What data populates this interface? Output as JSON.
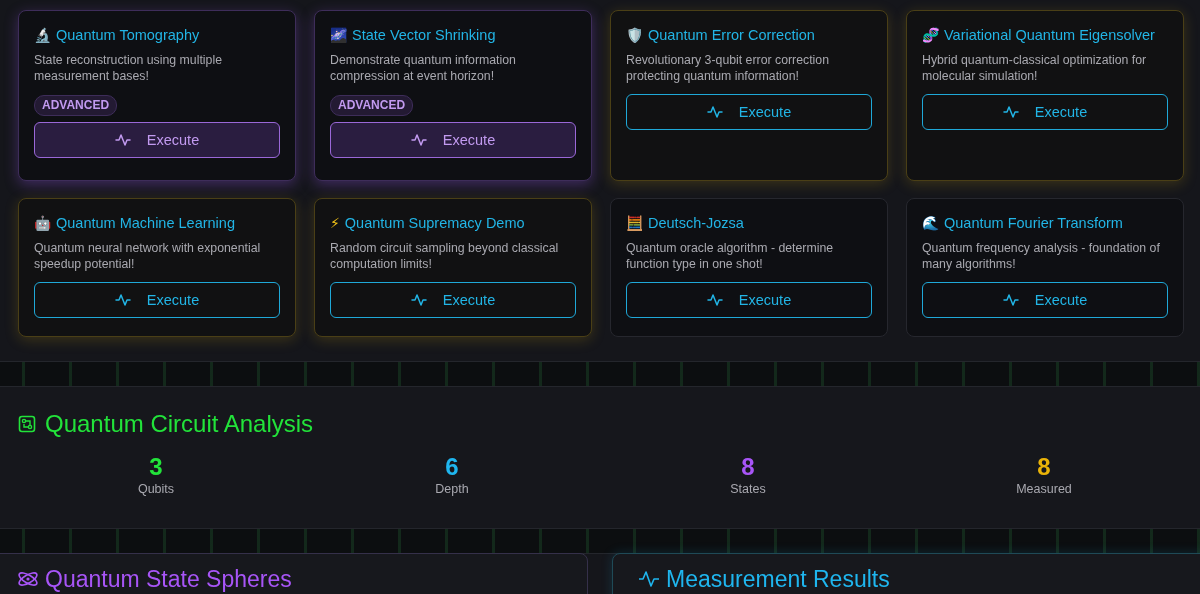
{
  "algorithms": [
    {
      "icon": "🔬",
      "title": "Quantum Tomography",
      "description": "State reconstruction using multiple measurement bases!",
      "badge": "ADVANCED",
      "kind": "advanced",
      "button": "Execute"
    },
    {
      "icon": "🌌",
      "title": "State Vector Shrinking",
      "description": "Demonstrate quantum information compression at event horizon!",
      "badge": "ADVANCED",
      "kind": "advanced",
      "button": "Execute"
    },
    {
      "icon": "🛡️",
      "title": "Quantum Error Correction",
      "description": "Revolutionary 3-qubit error correction protecting quantum information!",
      "kind": "featured",
      "button": "Execute"
    },
    {
      "icon": "🧬",
      "title": "Variational Quantum Eigensolver",
      "description": "Hybrid quantum-classical optimization for molecular simulation!",
      "kind": "featured",
      "button": "Execute"
    },
    {
      "icon": "🤖",
      "title": "Quantum Machine Learning",
      "description": "Quantum neural network with exponential speedup potential!",
      "kind": "featured",
      "button": "Execute"
    },
    {
      "icon": "⚡",
      "title": "Quantum Supremacy Demo",
      "description": "Random circuit sampling beyond classical computation limits!",
      "kind": "featured",
      "button": "Execute"
    },
    {
      "icon": "🧮",
      "title": "Deutsch-Jozsa",
      "description": "Quantum oracle algorithm - determine function type in one shot!",
      "kind": "basic",
      "button": "Execute"
    },
    {
      "icon": "🌊",
      "title": "Quantum Fourier Transform",
      "description": "Quantum frequency analysis - foundation of many algorithms!",
      "kind": "basic",
      "button": "Execute"
    }
  ],
  "analysis": {
    "title": "Quantum Circuit Analysis",
    "stats": [
      {
        "value": "3",
        "label": "Qubits",
        "color": "#22e33a"
      },
      {
        "value": "6",
        "label": "Depth",
        "color": "#1fb6ef"
      },
      {
        "value": "8",
        "label": "States",
        "color": "#a855f7"
      },
      {
        "value": "8",
        "label": "Measured",
        "color": "#eab308"
      }
    ]
  },
  "panels": [
    {
      "title": "Quantum State Spheres",
      "kind": "spheres"
    },
    {
      "title": "Measurement Results",
      "kind": "measurement"
    }
  ]
}
